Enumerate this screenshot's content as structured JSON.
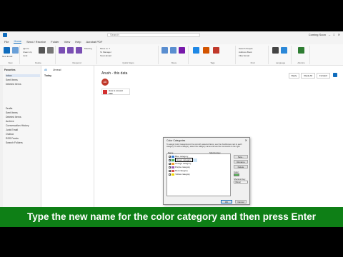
{
  "titlebar": {
    "search_placeholder": "Search",
    "right_label": "Coming Soon"
  },
  "menus": [
    "File",
    "Home",
    "Send / Receive",
    "Folder",
    "View",
    "Help",
    "Acrobat PDF"
  ],
  "ribbon": {
    "groups": [
      "New",
      "Delete",
      "Respond",
      "Quick Steps",
      "Move",
      "Tags",
      "Find",
      "Language",
      "Add-ins"
    ],
    "buttons": [
      "New Email",
      "New Items",
      "Ignore",
      "Clean Up",
      "Junk",
      "Delete",
      "Archive",
      "Reply",
      "Reply All",
      "Forward",
      "Meeting",
      "Move to: ?",
      "To Manager",
      "Team Email",
      "Move",
      "Rules",
      "OneNote",
      "Unread/Read",
      "Categorize",
      "Follow Up",
      "Search People",
      "Address Book",
      "Filter Email",
      "Read Aloud",
      "Translate",
      "Get Add-ins"
    ]
  },
  "folders": {
    "favorites_label": "Favorites",
    "items": [
      "Inbox",
      "Sent Items",
      "Deleted Items"
    ],
    "account_items": [
      "Drafts",
      "Sent Items",
      "Deleted Items",
      "Archive",
      "Conversation History",
      "Junk Email",
      "Outbox",
      "RSS Feeds",
      "Search Folders"
    ]
  },
  "message_list": {
    "tab_all": "All",
    "tab_unread": "Unread",
    "group_today": "Today"
  },
  "reading": {
    "sender": "Arush - this data",
    "avatar_initials": "AD",
    "attachment_name": "How to convert",
    "attachment_type": "PDF",
    "actions": [
      "Reply",
      "Reply All",
      "Forward"
    ]
  },
  "dialog": {
    "title": "Color Categories",
    "description": "To assign Color Categories to the currently selected items, use the checkboxes next to each category. To edit a category, select the category name and use the commands to the right.",
    "col_name": "Name",
    "col_shortcut": "Shortcut key",
    "categories": [
      {
        "name": "Blue category",
        "color": "#3a7fd5",
        "checked": false
      },
      {
        "name": "Green category",
        "color": "#5cb85c",
        "checked": false
      },
      {
        "name": "Orange category",
        "color": "#f0a030",
        "checked": false
      },
      {
        "name": "Purple category",
        "color": "#9b59b6",
        "checked": false
      },
      {
        "name": "Red category",
        "color": "#d9534f",
        "checked": false
      },
      {
        "name": "Yellow category",
        "color": "#f2d600",
        "checked": false
      }
    ],
    "buttons": [
      "New...",
      "Rename",
      "Delete"
    ],
    "color_label": "Color:",
    "shortcut_label": "Shortcut Key:",
    "shortcut_value": "(None)",
    "ok": "OK",
    "cancel": "Cancel"
  },
  "caption": "Type the new name for the color category and then press Enter"
}
